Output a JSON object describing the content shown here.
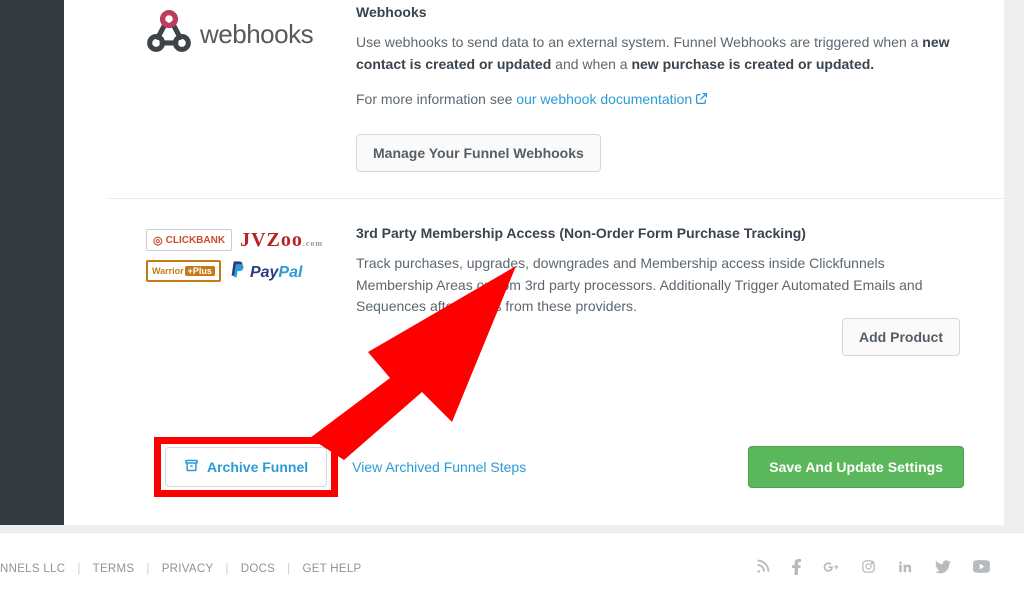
{
  "webhooks": {
    "logo_text": "webhooks",
    "heading": "Webhooks",
    "desc_1a": "Use webhooks to send data to an external system. Funnel Webhooks are triggered when a ",
    "desc_1b": "new contact is created or updated",
    "desc_1c": " and when a ",
    "desc_1d": "new purchase is created or updated.",
    "desc_2a": "For more information see ",
    "doc_link": "our webhook documentation",
    "manage_btn": "Manage Your Funnel Webhooks"
  },
  "third_party": {
    "heading": "3rd Party Membership Access (Non-Order Form Purchase Tracking)",
    "desc": "Track purchases, upgrades, downgrades and Membership access inside Clickfunnels Membership Areas or from 3rd party processors. Additionally Trigger Automated Emails and Sequences after orders from these providers.",
    "add_btn": "Add Product",
    "logos": {
      "clickbank": "CLICKBANK",
      "jvzoo": "JVZoo",
      "warrior": "Warrior",
      "warrior_plus": "+Plus",
      "paypal_pay": "Pay",
      "paypal_pal": "Pal"
    }
  },
  "bottom": {
    "archive_btn": "Archive Funnel",
    "view_archived": "View Archived Funnel Steps",
    "save_btn": "Save And Update Settings"
  },
  "footer": {
    "company": "NNELS LLC",
    "terms": "TERMS",
    "privacy": "PRIVACY",
    "docs": "DOCS",
    "help": "GET HELP"
  },
  "colors": {
    "highlight": "#ff0000",
    "link": "#2a9bd6",
    "green": "#5bb75b"
  }
}
